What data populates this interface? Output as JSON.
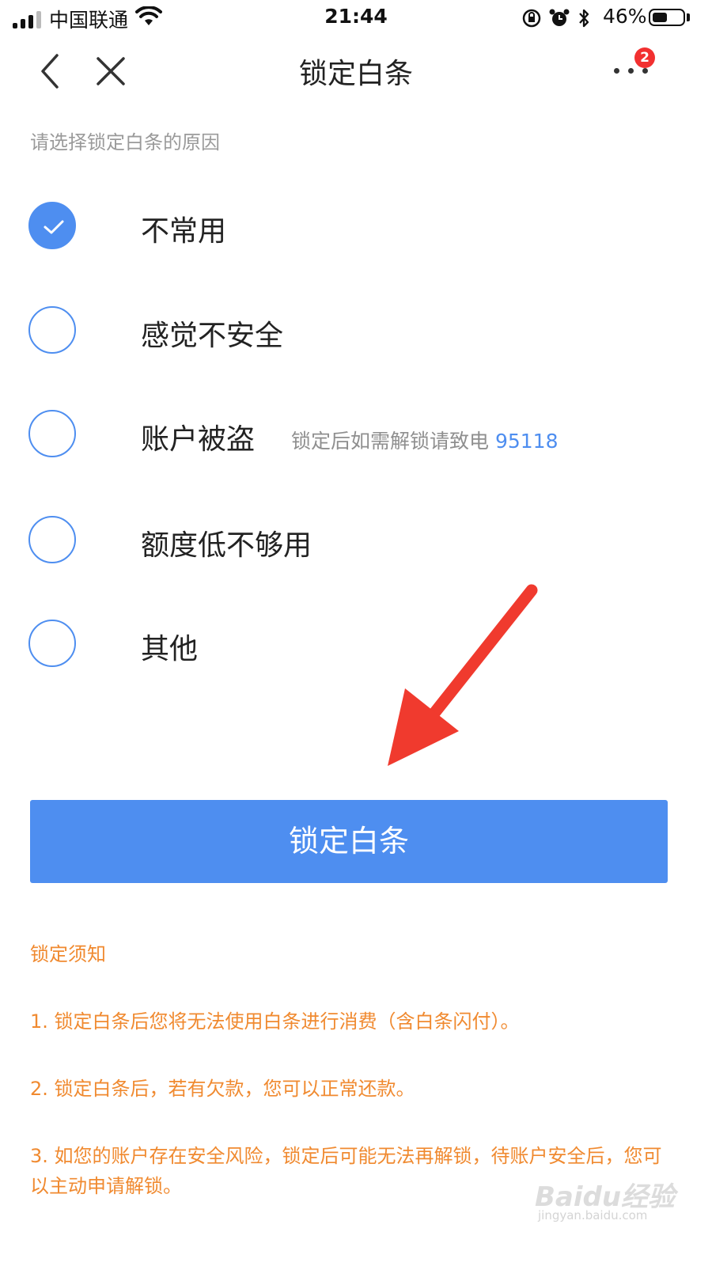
{
  "status_bar": {
    "carrier": "中国联通",
    "time": "21:44",
    "battery": "46%",
    "battery_level": 0.46,
    "icons": [
      "signal-icon",
      "wifi-icon",
      "rotation-lock-icon",
      "alarm-icon",
      "bluetooth-icon",
      "battery-icon"
    ]
  },
  "nav": {
    "title": "锁定白条",
    "back_icon": "chevron-left-icon",
    "close_icon": "close-icon",
    "more_icon": "more-dots-icon",
    "badge_count": "2"
  },
  "prompt": "请选择锁定白条的原因",
  "options": [
    {
      "label": "不常用",
      "checked": true
    },
    {
      "label": "感觉不安全",
      "checked": false
    },
    {
      "label": "账户被盗",
      "checked": false,
      "hint": "锁定后如需解锁请致电",
      "phone": "95118"
    },
    {
      "label": "额度低不够用",
      "checked": false
    },
    {
      "label": "其他",
      "checked": false
    }
  ],
  "submit_label": "锁定白条",
  "notice": {
    "title": "锁定须知",
    "items": [
      "1. 锁定白条后您将无法使用白条进行消费（含白条闪付）。",
      "2. 锁定白条后，若有欠款，您可以正常还款。",
      "3. 如您的账户存在安全风险，锁定后可能无法再解锁，待账户安全后，您可以主动申请解锁。"
    ]
  },
  "watermark": {
    "logo_text": "Baidu经验",
    "url": "jingyan.baidu.com"
  },
  "colors": {
    "accent": "#4e8ef0",
    "notice": "#f08a30",
    "badge": "#f23030",
    "annotation": "#f03a2e"
  }
}
